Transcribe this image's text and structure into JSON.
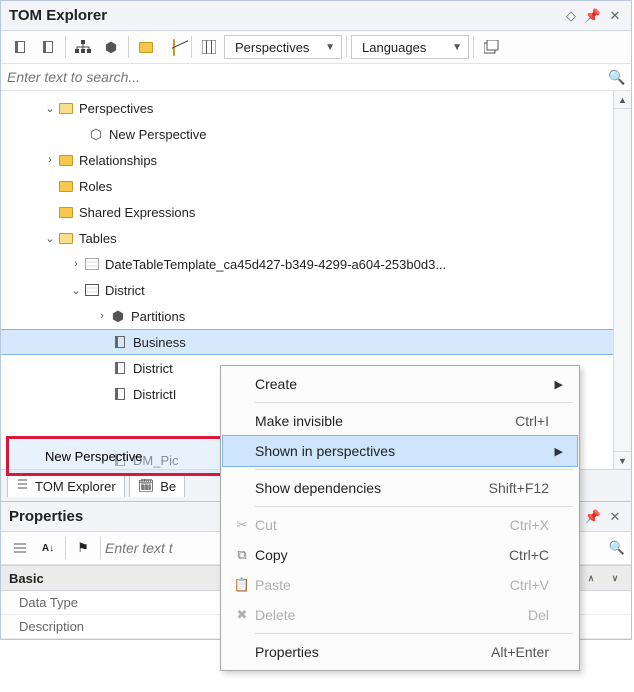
{
  "header": {
    "title": "TOM Explorer"
  },
  "toolbar": {
    "perspectives_dd": "Perspectives",
    "languages_dd": "Languages"
  },
  "search": {
    "placeholder": "Enter text to search..."
  },
  "tree": {
    "perspectives": "Perspectives",
    "new_perspective": "New Perspective",
    "relationships": "Relationships",
    "roles": "Roles",
    "shared_expressions": "Shared Expressions",
    "tables": "Tables",
    "date_template": "DateTableTemplate_ca45d427-b349-4299-a604-253b0d3...",
    "district": "District",
    "partitions": "Partitions",
    "col_business": "Business",
    "col_district": "District",
    "col_districtl": "DistrictI",
    "col_dm_pic": "DM_Pic"
  },
  "highlight": {
    "label": "New Perspective"
  },
  "context_menu": {
    "create": "Create",
    "make_invisible": "Make invisible",
    "make_invisible_sc": "Ctrl+I",
    "shown_in": "Shown in perspectives",
    "show_deps": "Show dependencies",
    "show_deps_sc": "Shift+F12",
    "cut": "Cut",
    "cut_sc": "Ctrl+X",
    "copy": "Copy",
    "copy_sc": "Ctrl+C",
    "paste": "Paste",
    "paste_sc": "Ctrl+V",
    "delete": "Delete",
    "delete_sc": "Del",
    "properties": "Properties",
    "properties_sc": "Alt+Enter"
  },
  "tabs": {
    "tom_explorer": "TOM Explorer",
    "be": "Be"
  },
  "properties": {
    "title": "Properties",
    "search_placeholder": "Enter text t",
    "cat_basic": "Basic",
    "row_datatype": "Data Type",
    "row_description": "Description"
  }
}
